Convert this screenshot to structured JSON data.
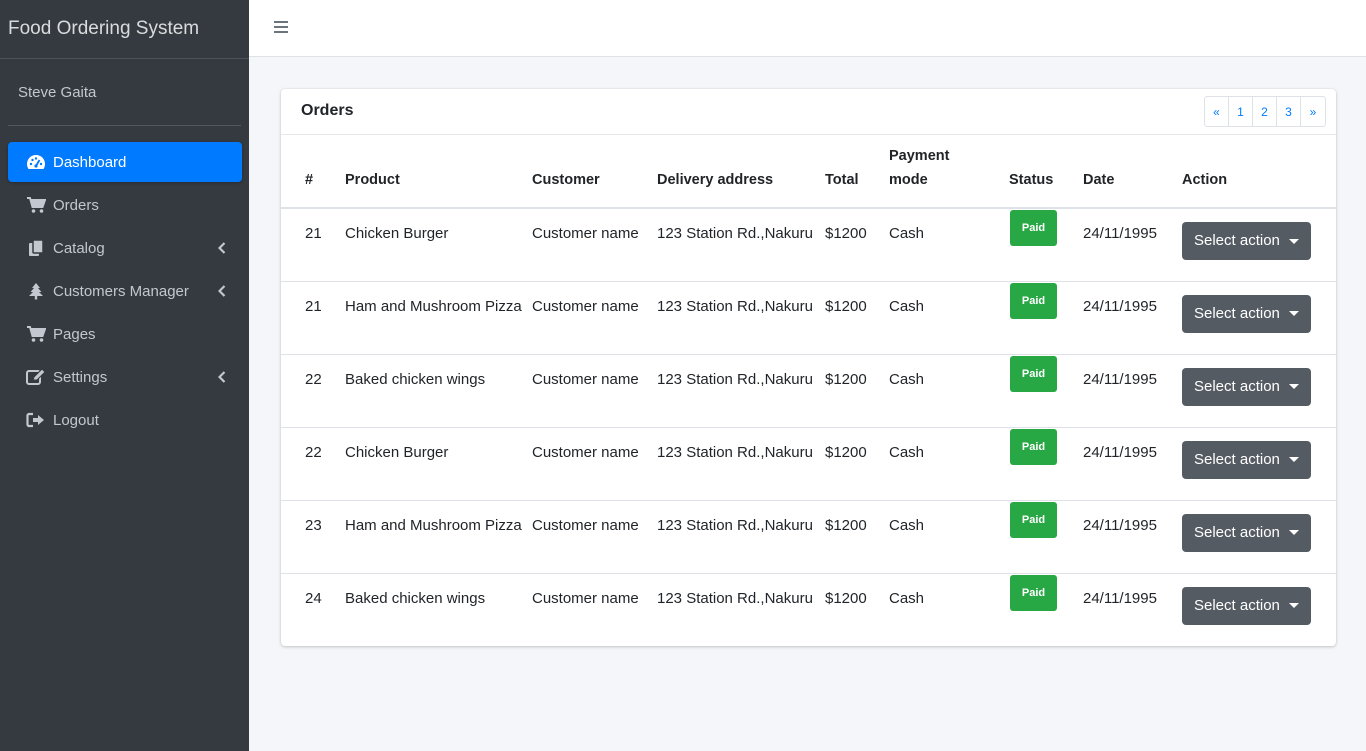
{
  "app": {
    "title": "Food Ordering System"
  },
  "user": {
    "name": "Steve Gaita"
  },
  "sidebar": {
    "items": [
      {
        "label": "Dashboard",
        "icon": "dashboard-icon",
        "active": true
      },
      {
        "label": "Orders",
        "icon": "cart-icon"
      },
      {
        "label": "Catalog",
        "icon": "copy-icon",
        "has_submenu": true
      },
      {
        "label": "Customers Manager",
        "icon": "tree-icon",
        "has_submenu": true
      },
      {
        "label": "Pages",
        "icon": "cart-icon"
      },
      {
        "label": "Settings",
        "icon": "edit-icon",
        "has_submenu": true
      },
      {
        "label": "Logout",
        "icon": "sign-out-icon"
      }
    ]
  },
  "orders": {
    "title": "Orders",
    "pagination": [
      "«",
      "1",
      "2",
      "3",
      "»"
    ],
    "headers": [
      "#",
      "Product",
      "Customer",
      "Delivery address",
      "Total",
      "Payment mode",
      "Status",
      "Date",
      "Action"
    ],
    "rows": [
      {
        "id": "21",
        "product": "Chicken Burger",
        "customer": "Customer name",
        "address": "123 Station Rd.,Nakuru",
        "total": "$1200",
        "payment": "Cash",
        "status": "Paid",
        "date": "24/11/1995",
        "action": "Select action"
      },
      {
        "id": "21",
        "product": "Ham and Mushroom Pizza",
        "customer": "Customer name",
        "address": "123 Station Rd.,Nakuru",
        "total": "$1200",
        "payment": "Cash",
        "status": "Paid",
        "date": "24/11/1995",
        "action": "Select action"
      },
      {
        "id": "22",
        "product": "Baked chicken wings",
        "customer": "Customer name",
        "address": "123 Station Rd.,Nakuru",
        "total": "$1200",
        "payment": "Cash",
        "status": "Paid",
        "date": "24/11/1995",
        "action": "Select action"
      },
      {
        "id": "22",
        "product": "Chicken Burger",
        "customer": "Customer name",
        "address": "123 Station Rd.,Nakuru",
        "total": "$1200",
        "payment": "Cash",
        "status": "Paid",
        "date": "24/11/1995",
        "action": "Select action"
      },
      {
        "id": "23",
        "product": "Ham and Mushroom Pizza",
        "customer": "Customer name",
        "address": "123 Station Rd.,Nakuru",
        "total": "$1200",
        "payment": "Cash",
        "status": "Paid",
        "date": "24/11/1995",
        "action": "Select action"
      },
      {
        "id": "24",
        "product": "Baked chicken wings",
        "customer": "Customer name",
        "address": "123 Station Rd.,Nakuru",
        "total": "$1200",
        "payment": "Cash",
        "status": "Paid",
        "date": "24/11/1995",
        "action": "Select action"
      }
    ]
  },
  "colors": {
    "sidebar_bg": "#343a40",
    "accent": "#007bff",
    "status_paid": "#28a745",
    "action_button": "#545b62"
  }
}
